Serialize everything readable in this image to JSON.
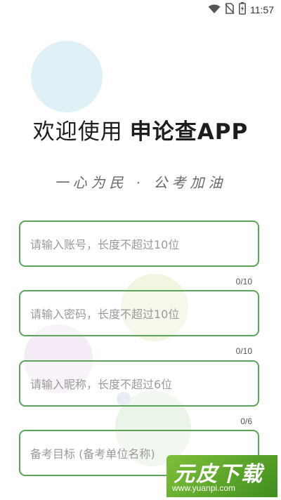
{
  "status_bar": {
    "time": "11:57"
  },
  "header": {
    "welcome": "欢迎使用",
    "app_name": "申论查APP",
    "slogan": "一心为民 · 公考加油"
  },
  "form": {
    "account": {
      "placeholder": "请输入账号，长度不超过10位",
      "counter": "0/10"
    },
    "password": {
      "placeholder": "请输入密码，长度不超过10位",
      "counter": "0/10"
    },
    "nickname": {
      "placeholder": "请输入昵称，长度不超过6位",
      "counter": "0/6"
    },
    "target": {
      "placeholder": "备考目标 (备考单位名称)"
    }
  },
  "watermark": {
    "logo": "元皮下载",
    "url": "www.yuanpi.com"
  },
  "colors": {
    "accent": "#5aa55a",
    "background": "#ffffff"
  }
}
